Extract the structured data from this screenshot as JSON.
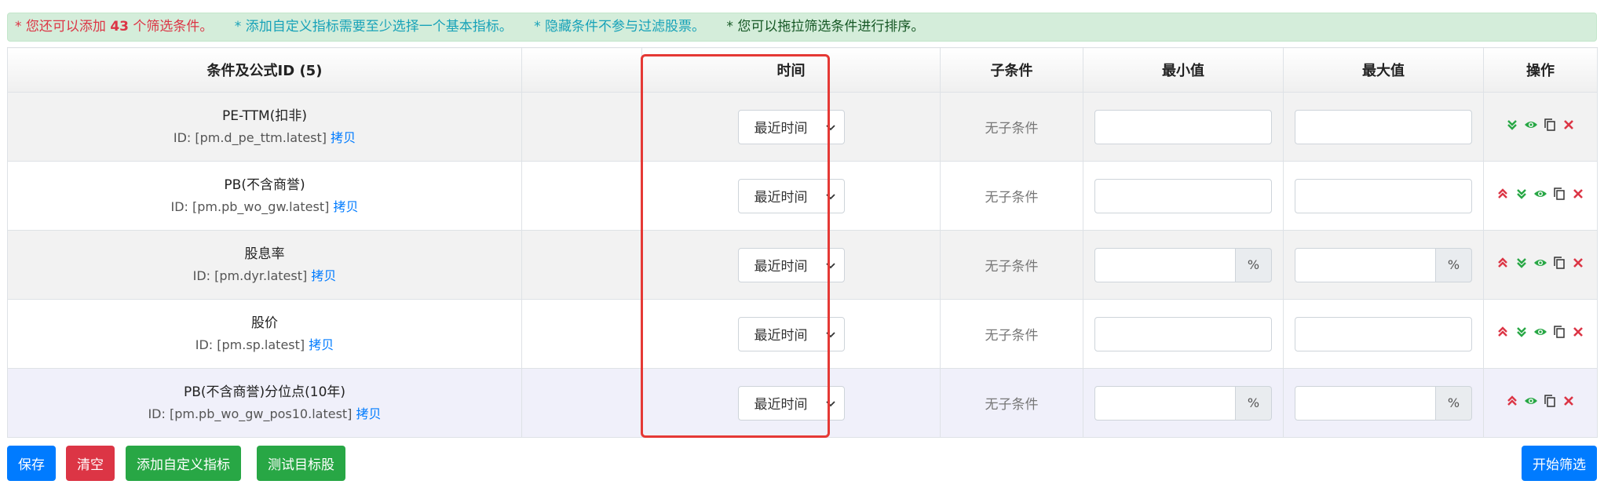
{
  "notice": {
    "n1_prefix": "* 您还可以添加 ",
    "n1_count": "43",
    "n1_suffix": " 个筛选条件。",
    "n2": "* 添加自定义指标需要至少选择一个基本指标。",
    "n3": "* 隐藏条件不参与过滤股票。",
    "n4": "* 您可以拖拉筛选条件进行排序。"
  },
  "table": {
    "headers": {
      "cond": "条件及公式ID (5)",
      "blank": "",
      "time": "时间",
      "sub": "子条件",
      "min": "最小值",
      "max": "最大值",
      "ops": "操作"
    },
    "rows": [
      {
        "name": "PE-TTM(扣非)",
        "id_text": "ID: [pm.d_pe_ttm.latest]",
        "copy": "拷贝",
        "time": "最近时间",
        "sub": "无子条件",
        "min": "",
        "max": "",
        "unit": ""
      },
      {
        "name": "PB(不含商誉)",
        "id_text": "ID: [pm.pb_wo_gw.latest]",
        "copy": "拷贝",
        "time": "最近时间",
        "sub": "无子条件",
        "min": "",
        "max": "",
        "unit": ""
      },
      {
        "name": "股息率",
        "id_text": "ID: [pm.dyr.latest]",
        "copy": "拷贝",
        "time": "最近时间",
        "sub": "无子条件",
        "min": "",
        "max": "",
        "unit": "%"
      },
      {
        "name": "股价",
        "id_text": "ID: [pm.sp.latest]",
        "copy": "拷贝",
        "time": "最近时间",
        "sub": "无子条件",
        "min": "",
        "max": "",
        "unit": ""
      },
      {
        "name": "PB(不含商誉)分位点(10年)",
        "id_text": "ID: [pm.pb_wo_gw_pos10.latest]",
        "copy": "拷贝",
        "time": "最近时间",
        "sub": "无子条件",
        "min": "",
        "max": "",
        "unit": "%"
      }
    ]
  },
  "buttons": {
    "save": "保存",
    "clear": "清空",
    "add_custom": "添加自定义指标",
    "test": "测试目标股",
    "start": "开始筛选"
  },
  "colors": {
    "primary": "#007bff",
    "danger": "#dc3545",
    "success": "#28a745",
    "highlight_box": "#e53935"
  }
}
